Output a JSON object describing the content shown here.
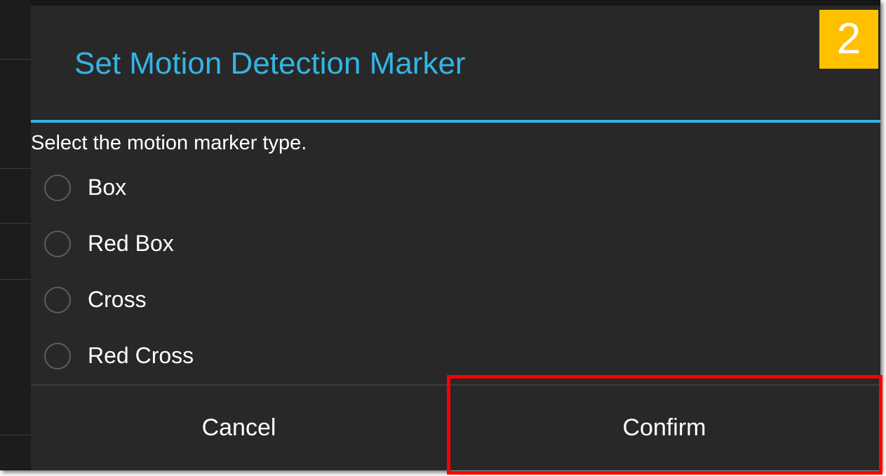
{
  "dialog": {
    "title": "Set Motion Detection Marker",
    "message": "Select the motion marker type.",
    "options": [
      {
        "label": "Box",
        "selected": false
      },
      {
        "label": "Red Box",
        "selected": false
      },
      {
        "label": "Cross",
        "selected": false
      },
      {
        "label": "Red Cross",
        "selected": false
      }
    ],
    "buttons": {
      "cancel_label": "Cancel",
      "confirm_label": "Confirm"
    }
  },
  "annotation": {
    "step_number": "2",
    "badge_color": "#ffc000",
    "highlight_color": "#ff0000",
    "highlighted_control": "confirm-button"
  },
  "theme": {
    "accent": "#33b5e5",
    "dialog_background": "#282828",
    "text_color": "#ffffff"
  }
}
